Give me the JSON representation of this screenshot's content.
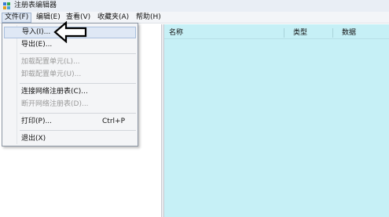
{
  "window": {
    "title": "注册表编辑器",
    "icon": "regedit-icon"
  },
  "menubar": {
    "items": [
      {
        "label": "文件(F)"
      },
      {
        "label": "编辑(E)"
      },
      {
        "label": "查看(V)"
      },
      {
        "label": "收藏夹(A)"
      },
      {
        "label": "帮助(H)"
      }
    ],
    "active": "文件(F)"
  },
  "file_menu": {
    "items": [
      {
        "label": "导入(I)...",
        "state": "highlighted"
      },
      {
        "label": "导出(E)...",
        "state": "enabled"
      },
      {
        "label": "加载配置单元(L)...",
        "state": "disabled"
      },
      {
        "label": "卸载配置单元(U)...",
        "state": "disabled"
      },
      {
        "label": "连接网络注册表(C)...",
        "state": "enabled"
      },
      {
        "label": "断开网络注册表(D)...",
        "state": "disabled"
      },
      {
        "label": "打印(P)...",
        "state": "enabled",
        "shortcut": "Ctrl+P"
      },
      {
        "label": "退出(X)",
        "state": "enabled"
      }
    ]
  },
  "list_view": {
    "columns": [
      {
        "label": "名称"
      },
      {
        "label": "类型"
      },
      {
        "label": "数据"
      }
    ]
  },
  "annotation": {
    "icon": "left-arrow-icon",
    "color": "#000000"
  },
  "colors": {
    "right_pane": "#c6f0f6",
    "menu_highlight": "#dfe8f5"
  }
}
